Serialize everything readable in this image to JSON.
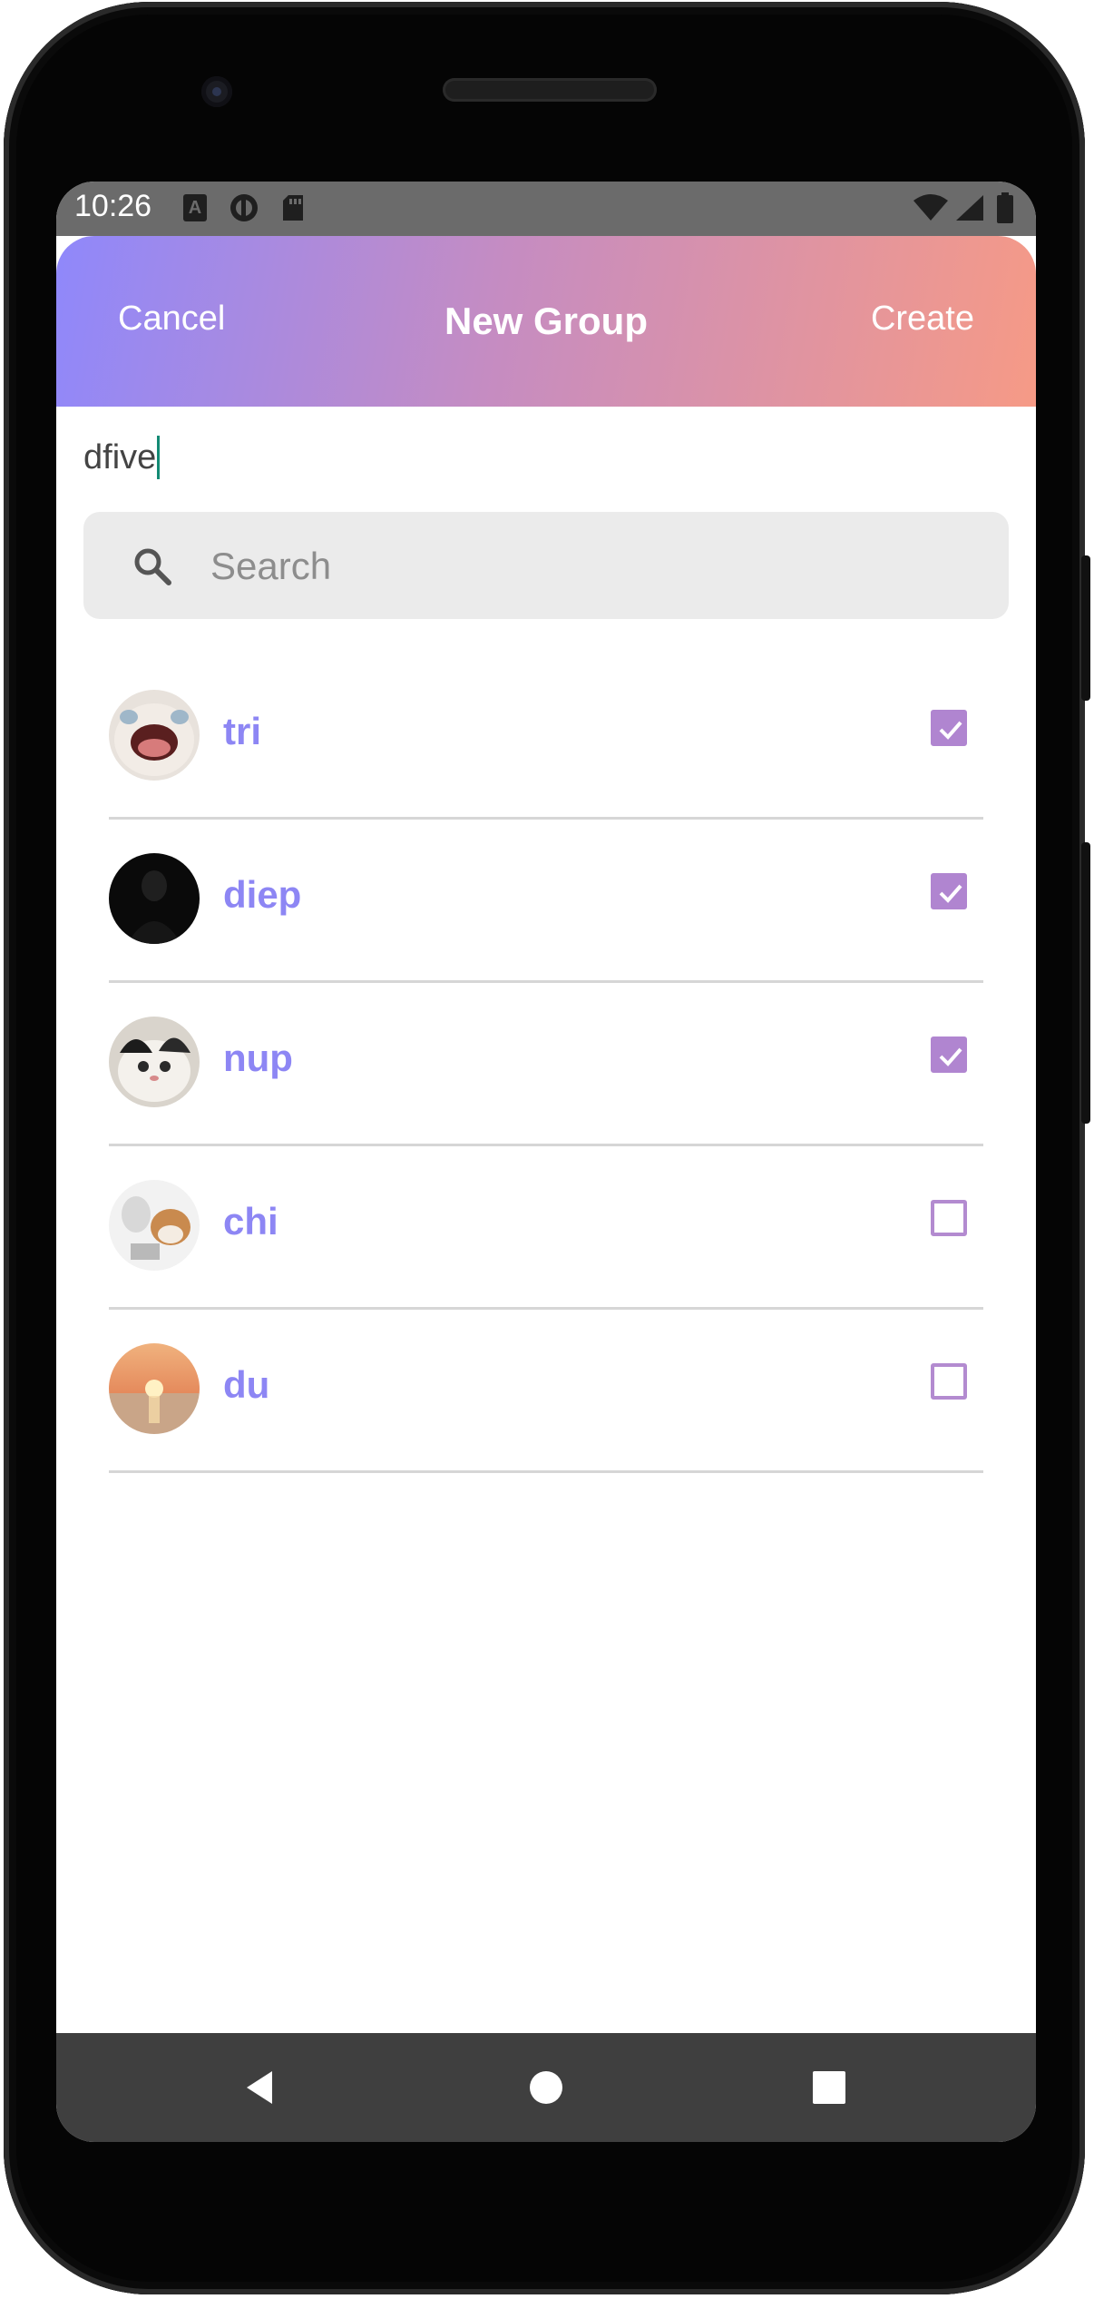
{
  "status_bar": {
    "time": "10:26",
    "left_icons": [
      "a-box-icon",
      "contrast-icon",
      "sd-card-icon"
    ],
    "right_icons": [
      "wifi-icon",
      "signal-icon",
      "battery-icon"
    ]
  },
  "header": {
    "cancel_label": "Cancel",
    "title": "New Group",
    "create_label": "Create"
  },
  "group_name": {
    "value": "dfive"
  },
  "search": {
    "placeholder": "Search",
    "icon": "search-icon"
  },
  "users": [
    {
      "name": "tri",
      "selected": true,
      "avatar": "crying-cat"
    },
    {
      "name": "diep",
      "selected": true,
      "avatar": "black-silhouette"
    },
    {
      "name": "nup",
      "selected": true,
      "avatar": "black-white-cat"
    },
    {
      "name": "chi",
      "selected": false,
      "avatar": "cat-with-laptop"
    },
    {
      "name": "du",
      "selected": false,
      "avatar": "sunset-sea"
    }
  ],
  "nav_bar": {
    "buttons": [
      "back-icon",
      "home-icon",
      "recents-icon"
    ]
  },
  "colors": {
    "header_gradient_start": "#8f88fb",
    "header_gradient_end": "#f69a86",
    "username": "#8d86f4",
    "checkbox": "#b085d0"
  }
}
